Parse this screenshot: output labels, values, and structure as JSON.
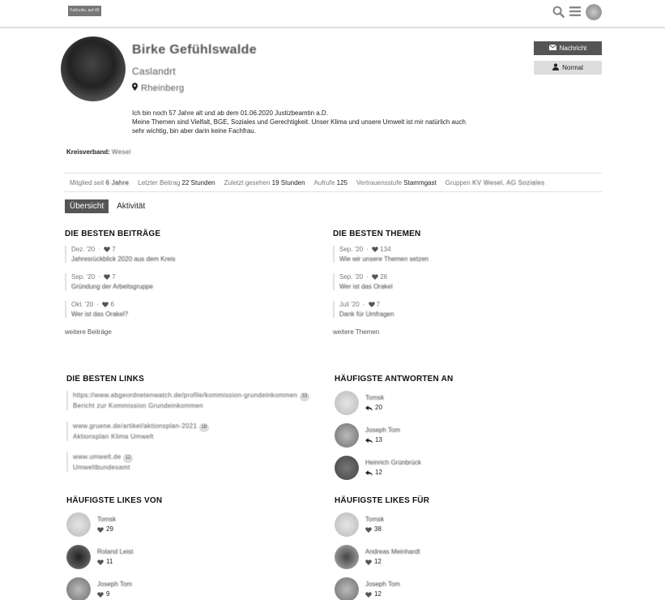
{
  "header": {
    "logo_text": "Fußnotiz, auf 40",
    "icons": [
      "search-icon",
      "menu-icon"
    ]
  },
  "profile": {
    "name": "Birke Gefühlswalde",
    "title": "Caslandrt",
    "location": "Rheinberg",
    "bio_line1": "Ich bin noch 57 Jahre alt und ab dem 01.06.2020 Justizbeamtin a.D.",
    "bio_line2": "Meine Themen sind Vielfalt, BGE, Soziales und Gerechtigkeit. Unser Klima und unsere Umwelt ist mir natürlich auch",
    "bio_line3": "sehr wichtig, bin aber darin keine Fachfrau.",
    "kreis_label": "Kreisverband:",
    "kreis_value": "Wesel"
  },
  "buttons": {
    "message": "Nachricht",
    "normal": "Normal"
  },
  "stats": {
    "member_label": "Mitglied seit",
    "member_value": "6 Jahre",
    "last_post_label": "Letzter Beitrag",
    "last_post_value": "22 Stunden",
    "last_seen_label": "Zuletzt gesehen",
    "last_seen_value": "19 Stunden",
    "views_label": "Aufrufe",
    "views_value": "125",
    "trust_label": "Vertrauensstufe",
    "trust_value": "Stammgast",
    "groups_label": "Gruppen",
    "groups_value": "KV Wesel, AG Soziales"
  },
  "tabs": {
    "overview": "Übersicht",
    "activity": "Aktivität"
  },
  "best_posts": {
    "title": "DIE BESTEN BEITRÄGE",
    "items": [
      {
        "date": "Dez. '20",
        "likes": "7",
        "title": "Jahresrückblick 2020 aus dem Kreis"
      },
      {
        "date": "Sep. '20",
        "likes": "7",
        "title": "Gründung der Arbeitsgruppe"
      },
      {
        "date": "Okt. '20",
        "likes": "6",
        "title": "Wer ist das Orakel?"
      }
    ],
    "more": "weitere Beiträge"
  },
  "best_topics": {
    "title": "DIE BESTEN THEMEN",
    "items": [
      {
        "date": "Sep. '20",
        "likes": "134",
        "title": "Wie wir unsere Themen setzen"
      },
      {
        "date": "Sep. '20",
        "likes": "26",
        "title": "Wer ist das Orakel"
      },
      {
        "date": "Juli '20",
        "likes": "7",
        "title": "Dank für Umfragen"
      }
    ],
    "more": "weitere Themen"
  },
  "best_links": {
    "title": "DIE BESTEN LINKS",
    "items": [
      {
        "text": "https://www.abgeordnetenwatch.de/profile/kommission-grundeinkommen",
        "count": "33",
        "sub": "Bericht zur Kommission Grundeinkommen"
      },
      {
        "text": "www.gruene.de/artikel/aktionsplan-2021",
        "count": "18",
        "sub": "Aktionsplan Klima Umwelt"
      },
      {
        "text": "www.umwelt.de",
        "count": "12",
        "sub": "Umweltbundesamt"
      }
    ]
  },
  "most_replied": {
    "title": "HÄUFIGSTE ANTWORTEN AN",
    "items": [
      {
        "name": "Tomsk",
        "count": "20"
      },
      {
        "name": "Joseph Tom",
        "count": "13"
      },
      {
        "name": "Heinrich Grünbrück",
        "count": "12"
      }
    ]
  },
  "likes_from": {
    "title": "HÄUFIGSTE LIKES VON",
    "items": [
      {
        "name": "Tomsk",
        "count": "29"
      },
      {
        "name": "Roland Leist",
        "count": "11"
      },
      {
        "name": "Joseph Tom",
        "count": "9"
      }
    ]
  },
  "likes_for": {
    "title": "HÄUFIGSTE LIKES FÜR",
    "items": [
      {
        "name": "Tomsk",
        "count": "38"
      },
      {
        "name": "Andreas Meinhardt",
        "count": "12"
      },
      {
        "name": "Joseph Tom",
        "count": "12"
      }
    ]
  }
}
